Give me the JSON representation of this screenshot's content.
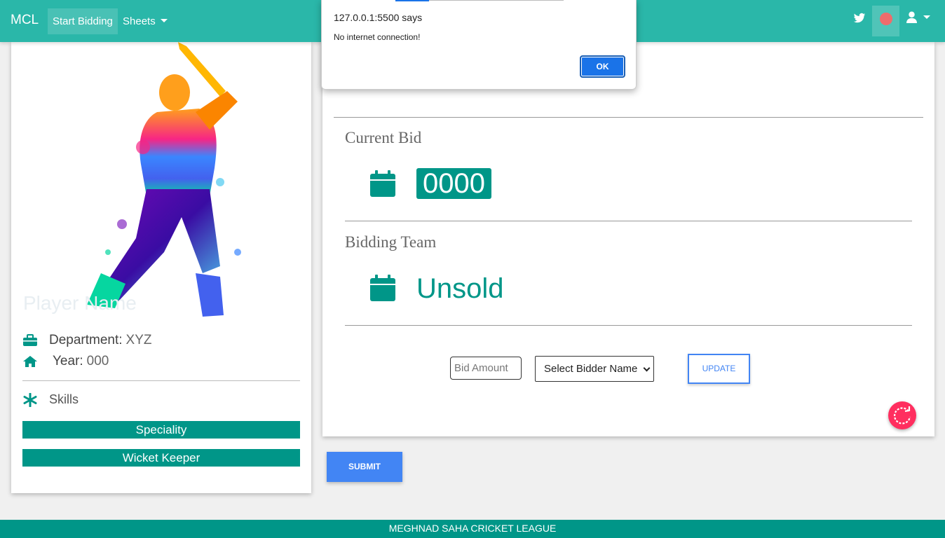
{
  "navbar": {
    "brand": "MCL",
    "items": [
      {
        "label": "Start Bidding",
        "active": true
      },
      {
        "label": "Sheets",
        "dropdown": true
      }
    ],
    "right_icons": [
      "twitter-icon",
      "status-dot-icon",
      "user-icon"
    ]
  },
  "player": {
    "name_placeholder": "Player Name",
    "department_label": "Department:",
    "department_value": "XYZ",
    "year_label": "Year:",
    "year_value": "000",
    "skills_label": "Skills",
    "skills": [
      "Speciality",
      "Wicket Keeper"
    ]
  },
  "bid": {
    "current_bid_label": "Current Bid",
    "current_bid_value": "0000",
    "bidding_team_label": "Bidding Team",
    "bidding_team_value": "Unsold",
    "amount_placeholder": "Bid Amount",
    "bidder_select_value": "Select Bidder Name",
    "update_label": "UPDATE",
    "submit_label": "SUBMIT"
  },
  "footer": {
    "text": "MEGHNAD SAHA CRICKET LEAGUE"
  },
  "alert": {
    "origin": "127.0.0.1:5500 says",
    "message": "No internet connection!",
    "ok_label": "OK"
  },
  "colors": {
    "navbar": "#2ab7a9",
    "teal": "#009688",
    "blue": "#4285f4",
    "refresh": "#ff2e5f"
  }
}
